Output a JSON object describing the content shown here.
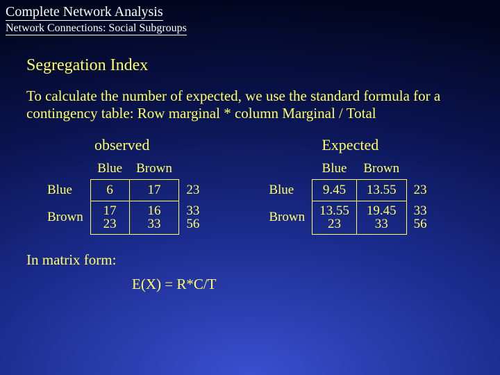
{
  "header": {
    "title": "Complete Network Analysis",
    "subtitle": "Network Connections: Social Subgroups"
  },
  "section_heading": "Segregation Index",
  "body_text": "To calculate the number of expected, we use the standard formula for a contingency table: Row marginal * column Marginal / Total",
  "observed": {
    "title": "observed",
    "col1": "Blue",
    "col2": "Brown",
    "row1_label": "Blue",
    "r1c1": "6",
    "r1c2": "17",
    "r1_marg": "23",
    "row2_label": "Brown",
    "r2c1_top": "17",
    "r2c1_bot": "23",
    "r2c2_top": "16",
    "r2c2_bot": "33",
    "r2_marg_top": "33",
    "r2_marg_bot": "56"
  },
  "expected": {
    "title": "Expected",
    "col1": "Blue",
    "col2": "Brown",
    "row1_label": "Blue",
    "r1c1": "9.45",
    "r1c2": "13.55",
    "r1_marg": "23",
    "row2_label": "Brown",
    "r2c1_top": "13.55",
    "r2c1_bot": "23",
    "r2c2_top": "19.45",
    "r2c2_bot": "33",
    "r2_marg_top": "33",
    "r2_marg_bot": "56"
  },
  "footer": "In matrix form:",
  "formula": "E(X) = R*C/T"
}
